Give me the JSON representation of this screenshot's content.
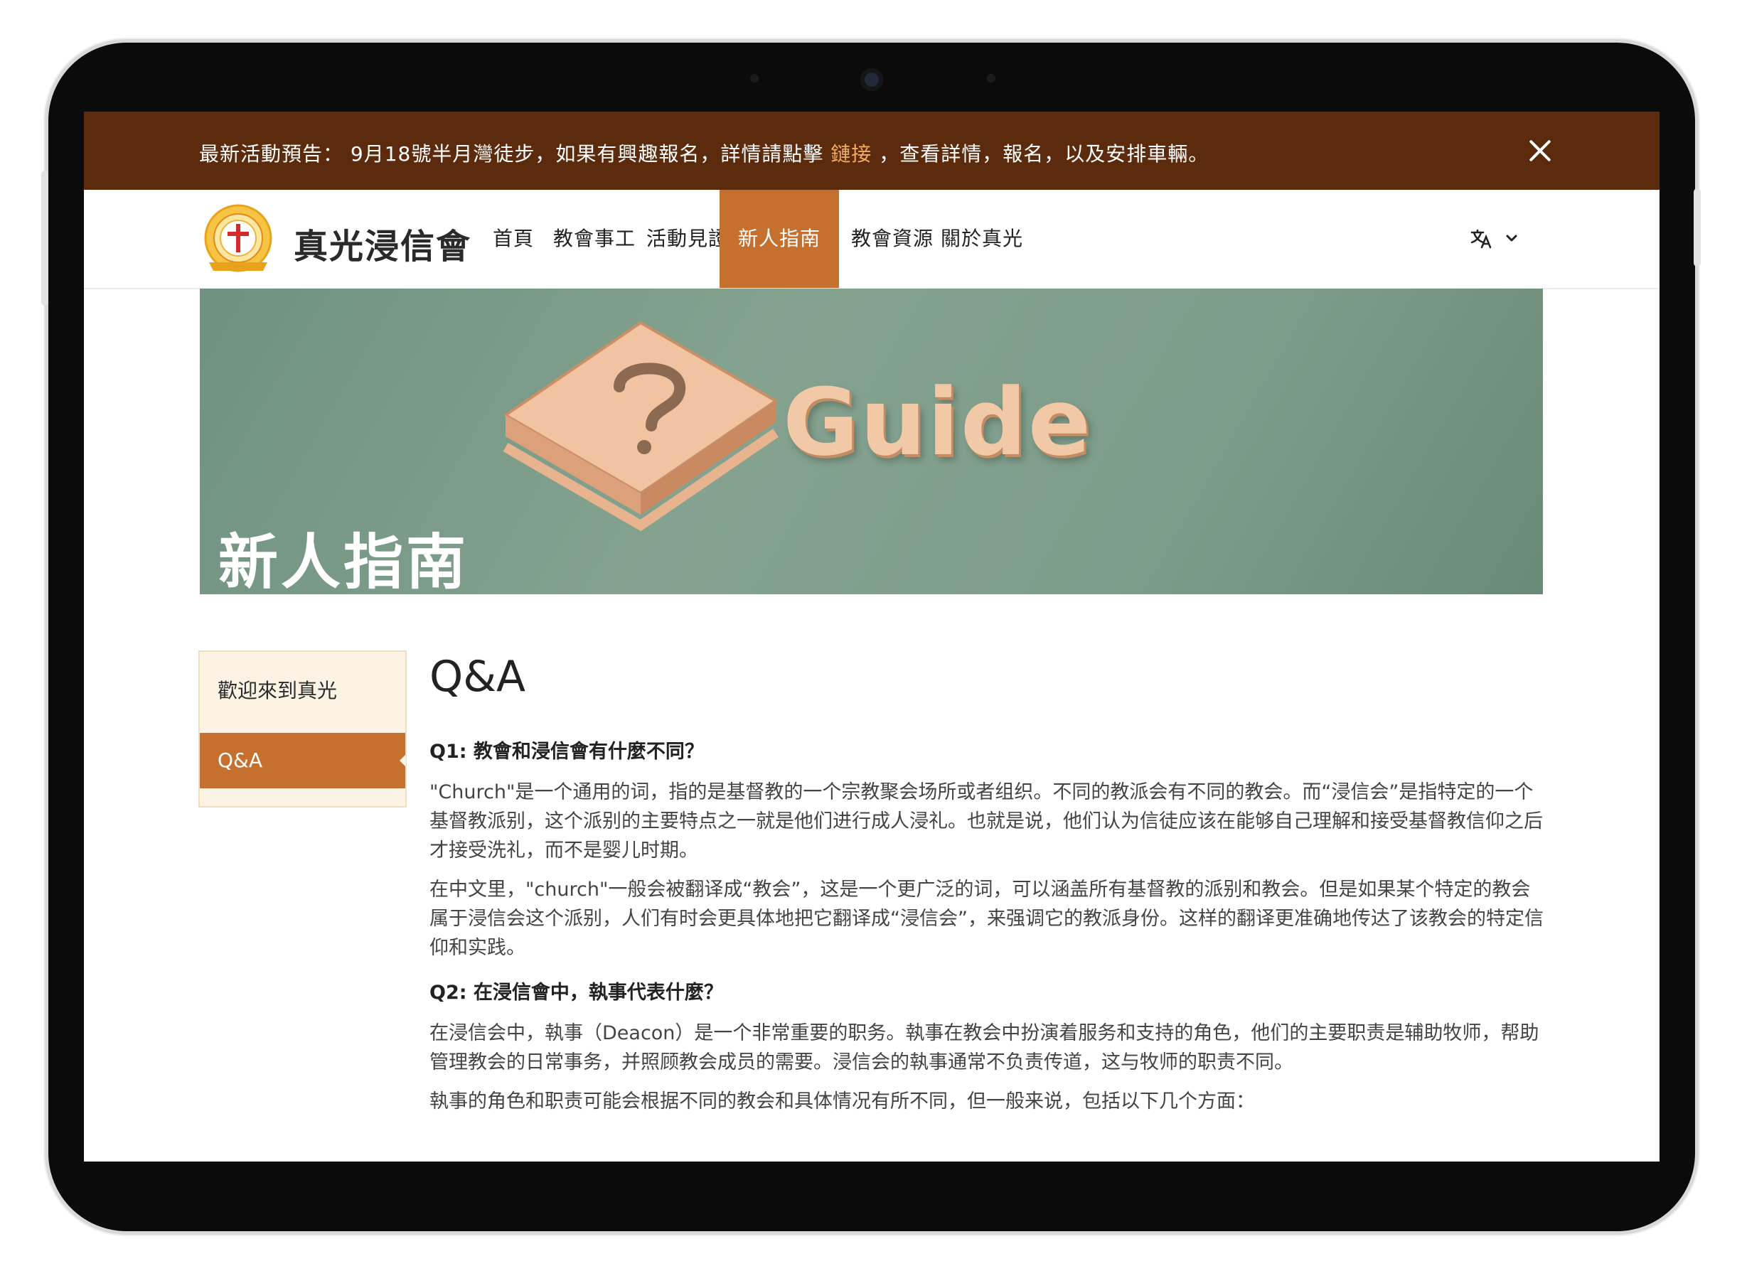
{
  "banner": {
    "text_before": "最新活動預告： 9月18號半月灣徒步，如果有興趣報名，詳情請點擊",
    "link_text": "鏈接",
    "text_after": "，查看詳情，報名，以及安排車輛。"
  },
  "header": {
    "brand": "真光浸信會"
  },
  "nav": {
    "items": [
      {
        "label": "首頁"
      },
      {
        "label": "教會事工"
      },
      {
        "label": "活動見證"
      },
      {
        "label": "新人指南"
      },
      {
        "label": "教會資源"
      },
      {
        "label": "關於真光"
      }
    ],
    "active_index": 3,
    "language_icon": "translate-icon"
  },
  "hero": {
    "title": "新人指南",
    "image_text": "Guide"
  },
  "sidebar": {
    "items": [
      {
        "label": "歡迎來到真光"
      },
      {
        "label": "Q&A"
      }
    ],
    "active_index": 1
  },
  "content": {
    "heading": "Q&A",
    "q1": {
      "question": "Q1: 教會和浸信會有什麼不同？",
      "p1": "\"Church\"是一个通用的词，指的是基督教的一个宗教聚会场所或者组织。不同的教派会有不同的教会。而“浸信会”是指特定的一个基督教派别，这个派别的主要特点之一就是他们进行成人浸礼。也就是说，他们认为信徒应该在能够自己理解和接受基督教信仰之后才接受洗礼，而不是婴儿时期。",
      "p2": "在中文里，\"church\"一般会被翻译成“教会”，这是一个更广泛的词，可以涵盖所有基督教的派别和教会。但是如果某个特定的教会属于浸信会这个派别，人们有时会更具体地把它翻译成“浸信会”，来强调它的教派身份。这样的翻译更准确地传达了该教会的特定信仰和实践。"
    },
    "q2": {
      "question": "Q2: 在浸信會中，執事代表什麼？",
      "p1": "在浸信会中，執事（Deacon）是一个非常重要的职务。執事在教会中扮演着服务和支持的角色，他们的主要职责是辅助牧师，帮助管理教会的日常事务，并照顾教会成员的需要。浸信会的執事通常不负责传道，这与牧师的职责不同。",
      "p2": "執事的角色和职责可能会根据不同的教会和具体情况有所不同，但一般来说，包括以下几个方面："
    }
  },
  "colors": {
    "banner_bg": "#5c2b0e",
    "accent": "#c5702e",
    "link": "#f2ac5f",
    "sidebar_bg": "#fdf3e4",
    "hero_bg": "#7e9d8a"
  }
}
